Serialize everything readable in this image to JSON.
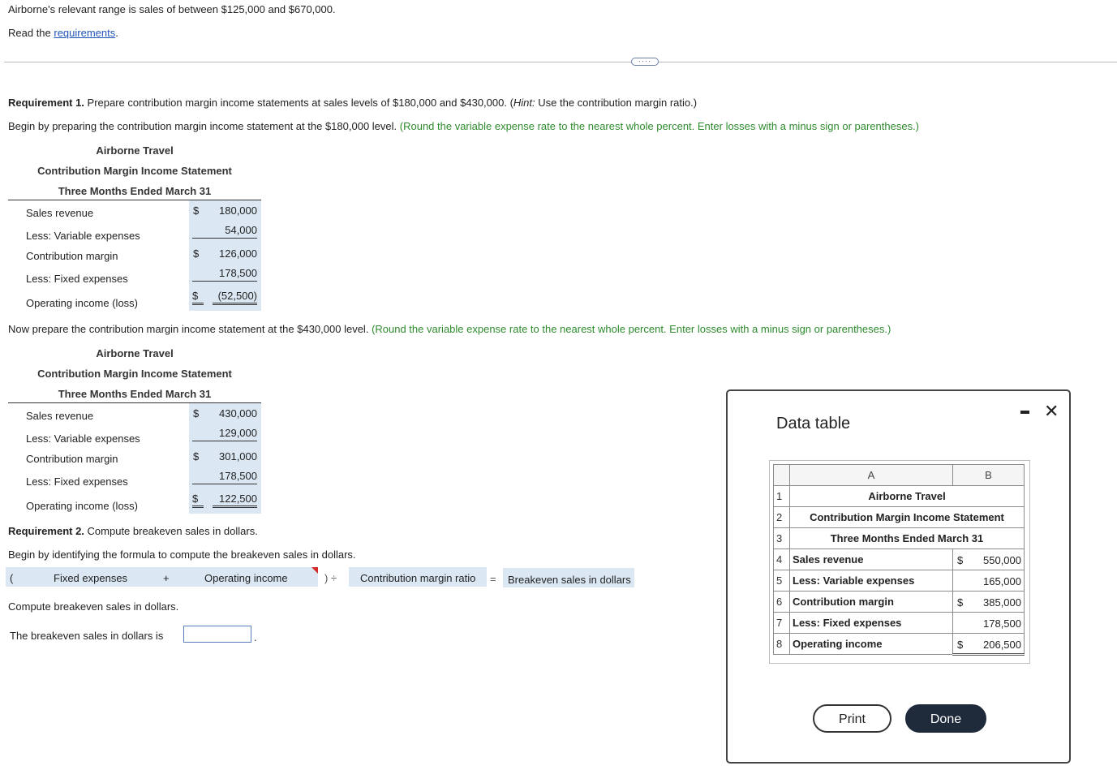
{
  "intro": {
    "range_text": "Airborne's relevant range is sales of between $125,000 and $670,000.",
    "read_prefix": "Read the ",
    "read_link": "requirements",
    "read_suffix": "."
  },
  "more_button": "····",
  "req1": {
    "title_bold": "Requirement 1.",
    "title_rest": " Prepare contribution margin income statements at sales levels of $180,000 and $430,000. (",
    "hint_italic": "Hint:",
    "hint_rest": " Use the contribution margin ratio.)",
    "begin_text": "Begin by preparing the contribution margin income statement at the $180,000 level.",
    "begin_note": "(Round the variable expense rate to the nearest whole percent. Enter losses with a minus sign or parentheses.)",
    "now_text": "Now prepare the contribution margin income statement at the $430,000 level.",
    "now_note": "(Round the variable expense rate to the nearest whole percent. Enter losses with a minus sign or parentheses.)"
  },
  "statement1": {
    "company": "Airborne Travel",
    "title": "Contribution Margin Income Statement",
    "period": "Three Months Ended March 31",
    "rows": [
      {
        "label": "Sales revenue",
        "dollar": "$",
        "value": "180,000"
      },
      {
        "label": "Less: Variable expenses",
        "dollar": "",
        "value": "54,000"
      },
      {
        "label": "Contribution margin",
        "dollar": "$",
        "value": "126,000"
      },
      {
        "label": "Less: Fixed expenses",
        "dollar": "",
        "value": "178,500"
      },
      {
        "label": "Operating income (loss)",
        "dollar": "$",
        "value": "(52,500)"
      }
    ]
  },
  "statement2": {
    "company": "Airborne Travel",
    "title": "Contribution Margin Income Statement",
    "period": "Three Months Ended March 31",
    "rows": [
      {
        "label": "Sales revenue",
        "dollar": "$",
        "value": "430,000"
      },
      {
        "label": "Less: Variable expenses",
        "dollar": "",
        "value": "129,000"
      },
      {
        "label": "Contribution margin",
        "dollar": "$",
        "value": "301,000"
      },
      {
        "label": "Less: Fixed expenses",
        "dollar": "",
        "value": "178,500"
      },
      {
        "label": "Operating income (loss)",
        "dollar": "$",
        "value": "122,500"
      }
    ]
  },
  "req2": {
    "title_bold": "Requirement 2.",
    "title_rest": " Compute breakeven sales in dollars.",
    "begin_text": "Begin by identifying the formula to compute the breakeven sales in dollars.",
    "formula": {
      "open_paren": "(",
      "term1": "Fixed expenses",
      "plus": "+",
      "term2": "Operating income",
      "close_div": ") ÷",
      "term3": "Contribution margin ratio",
      "equals": "=",
      "result": "Breakeven sales in dollars"
    },
    "compute_text": "Compute breakeven sales in dollars.",
    "answer_label": "The breakeven sales in dollars is",
    "answer_value": "",
    "answer_suffix": "."
  },
  "modal": {
    "title": "Data table",
    "col_a": "A",
    "col_b": "B",
    "rows": [
      {
        "n": "1",
        "text": "Airborne Travel"
      },
      {
        "n": "2",
        "text": "Contribution Margin Income Statement"
      },
      {
        "n": "3",
        "text": "Three Months Ended March 31"
      }
    ],
    "items": [
      {
        "n": "4",
        "label": "Sales revenue",
        "dollar": "$",
        "value": "550,000"
      },
      {
        "n": "5",
        "label": "Less: Variable expenses",
        "dollar": "",
        "value": "165,000"
      },
      {
        "n": "6",
        "label": "Contribution margin",
        "dollar": "$",
        "value": "385,000"
      },
      {
        "n": "7",
        "label": "Less: Fixed expenses",
        "dollar": "",
        "value": "178,500"
      },
      {
        "n": "8",
        "label": "Operating income",
        "dollar": "$",
        "value": "206,500"
      }
    ],
    "print_label": "Print",
    "done_label": "Done",
    "minimize_icon": "minimize-icon",
    "close_icon": "close-icon"
  },
  "colors": {
    "link": "#2255bb",
    "note_green": "#2e8b2e",
    "answer_shade": "#dbe7f3",
    "done_button": "#1f2a3a"
  }
}
